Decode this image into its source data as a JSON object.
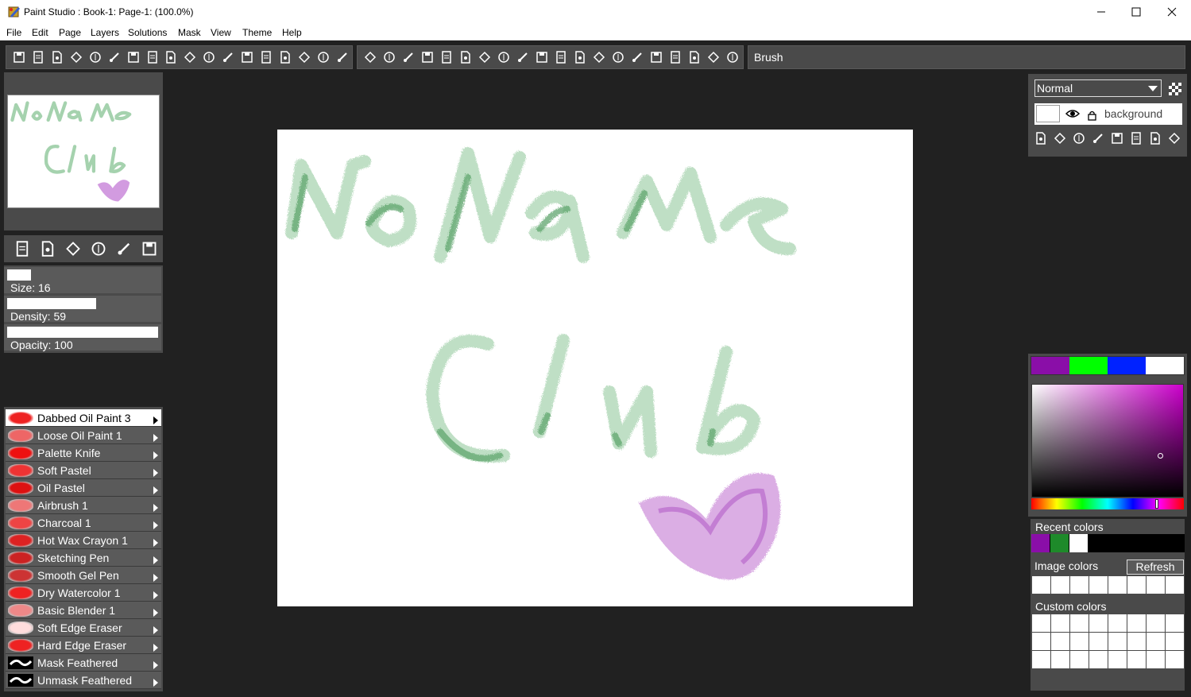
{
  "window": {
    "title": "Paint Studio : Book-1: Page-1:  (100.0%)"
  },
  "menu": [
    "File",
    "Edit",
    "Page",
    "Layers",
    "Solutions",
    "Mask",
    "View",
    "Theme",
    "Help"
  ],
  "toolbar": {
    "current_tool": "Brush",
    "file_icons": [
      "save-icon",
      "save-as-icon",
      "new-page-icon",
      "open-icon",
      "import-icon",
      "export-icon",
      "brush-settings-icon",
      "list-icon",
      "cut-icon",
      "copy-icon",
      "paste-icon",
      "undo-icon",
      "redo-icon",
      "undo-history-icon",
      "redo-history-icon",
      "zoom-in-icon",
      "fit-icon",
      "zoom-out-icon"
    ],
    "tool_icons": [
      "brush-icon",
      "eyedropper-icon",
      "crop-icon",
      "move-icon",
      "line-icon",
      "lasso-icon",
      "rectangle-icon",
      "ellipse-icon",
      "fill-icon",
      "gradient-icon",
      "pattern-icon",
      "symmetry-icon",
      "mirror-icon",
      "kaleidoscope-icon",
      "magic-wand-icon",
      "smudge-icon",
      "clone-icon",
      "stamp-icon",
      "hand-icon",
      "rotate-icon"
    ]
  },
  "quick_actions": [
    "new-canvas-icon",
    "rotate-canvas-icon",
    "flip-icon",
    "canvas-size-icon",
    "paint-bucket-icon",
    "settings-icon"
  ],
  "sliders": [
    {
      "label": "Size: 16",
      "value": 16,
      "max": 100
    },
    {
      "label": "Density: 59",
      "value": 59,
      "max": 100
    },
    {
      "label": "Opacity: 100",
      "value": 100,
      "max": 100
    }
  ],
  "brushes": [
    {
      "name": "Dabbed Oil Paint 3",
      "active": true,
      "color": "#ee2222"
    },
    {
      "name": "Loose Oil Paint 1",
      "active": false,
      "color": "#ee6666"
    },
    {
      "name": "Palette Knife",
      "active": false,
      "color": "#ee1111"
    },
    {
      "name": "Soft Pastel",
      "active": false,
      "color": "#ee3333"
    },
    {
      "name": "Oil Pastel",
      "active": false,
      "color": "#dd1111"
    },
    {
      "name": "Airbrush 1",
      "active": false,
      "color": "#ee7777"
    },
    {
      "name": "Charcoal 1",
      "active": false,
      "color": "#ee4444"
    },
    {
      "name": "Hot Wax Crayon 1",
      "active": false,
      "color": "#dd2222"
    },
    {
      "name": "Sketching Pen",
      "active": false,
      "color": "#cc2222"
    },
    {
      "name": "Smooth Gel Pen",
      "active": false,
      "color": "#cc3333"
    },
    {
      "name": "Dry Watercolor 1",
      "active": false,
      "color": "#ee2222"
    },
    {
      "name": "Basic Blender 1",
      "active": false,
      "color": "#ee8888"
    },
    {
      "name": "Soft Edge Eraser",
      "active": false,
      "color": "#ffdddd"
    },
    {
      "name": "Hard Edge Eraser",
      "active": false,
      "color": "#ee2222"
    },
    {
      "name": "Mask Feathered",
      "active": false,
      "color": "#000000"
    },
    {
      "name": "Unmask Feathered",
      "active": false,
      "color": "#000000"
    }
  ],
  "layers": {
    "blend_mode": "Normal",
    "items": [
      {
        "name": "background"
      }
    ],
    "action_icons": [
      "add-layer-icon",
      "import-layer-icon",
      "duplicate-layer-icon",
      "delete-layer-icon",
      "merge-layer-icon",
      "move-layer-down-icon",
      "layer-list-icon",
      "layer-properties-icon"
    ]
  },
  "colors": {
    "foreground_swatches": [
      "#8a0ea8",
      "#00ff00",
      "#0022ff",
      "#ffffff"
    ],
    "picker_hue": "#cc00cc",
    "recent_label": "Recent colors",
    "recent": [
      "#8a0ea8",
      "#1e8a2a",
      "#ffffff"
    ],
    "image_label": "Image colors",
    "refresh_label": "Refresh",
    "custom_label": "Custom colors"
  }
}
